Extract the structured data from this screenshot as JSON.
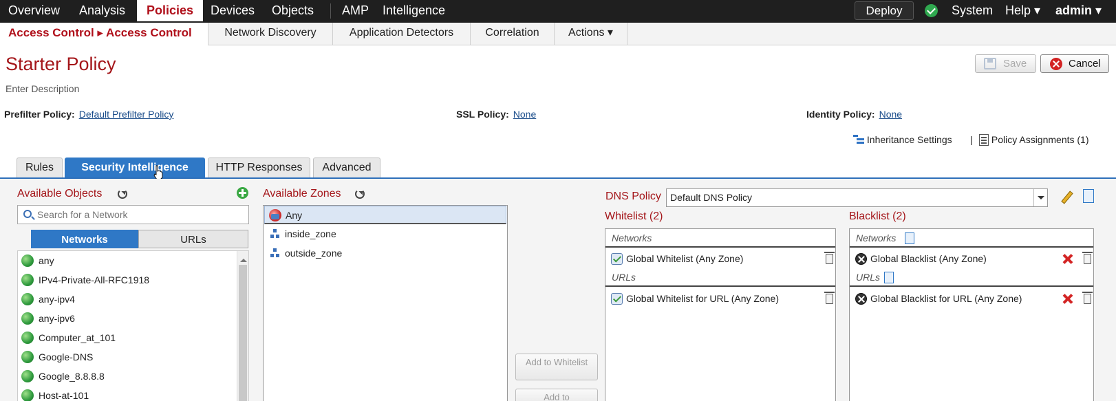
{
  "topnav": {
    "items": [
      "Overview",
      "Analysis",
      "Policies",
      "Devices",
      "Objects",
      "AMP",
      "Intelligence"
    ],
    "deploy": "Deploy",
    "system": "System",
    "help": "Help ▾",
    "user": "admin ▾"
  },
  "subnav": {
    "breadcrumb": "Access Control ▸ Access Control",
    "tabs": [
      "Network Discovery",
      "Application Detectors",
      "Correlation",
      "Actions ▾"
    ]
  },
  "policy": {
    "title": "Starter Policy",
    "description": "Enter Description",
    "save": "Save",
    "cancel": "Cancel",
    "prefilter_label": "Prefilter Policy:",
    "prefilter_value": "Default Prefilter Policy",
    "ssl_label": "SSL Policy:",
    "ssl_value": "None",
    "identity_label": "Identity Policy:",
    "identity_value": "None",
    "inheritance": "Inheritance Settings",
    "assignments": "Policy Assignments (1)",
    "separator": "|"
  },
  "tabs": [
    "Rules",
    "Security Intelligence",
    "HTTP Responses",
    "Advanced"
  ],
  "available_objects": {
    "title": "Available Objects",
    "search_placeholder": "Search for a Network",
    "seg_networks": "Networks",
    "seg_urls": "URLs",
    "items": [
      "any",
      "IPv4-Private-All-RFC1918",
      "any-ipv4",
      "any-ipv6",
      "Computer_at_101",
      "Google-DNS",
      "Google_8.8.8.8",
      "Host-at-101"
    ]
  },
  "available_zones": {
    "title": "Available Zones",
    "items": [
      "Any",
      "inside_zone",
      "outside_zone"
    ]
  },
  "add_buttons": {
    "whitelist": "Add to Whitelist",
    "blacklist": "Add to"
  },
  "dns": {
    "label": "DNS Policy",
    "value": "Default DNS Policy"
  },
  "whitelist": {
    "title": "Whitelist (2)",
    "networks_header": "Networks",
    "network_item": "Global Whitelist (Any Zone)",
    "urls_header": "URLs",
    "url_item": "Global Whitelist for URL (Any Zone)"
  },
  "blacklist": {
    "title": "Blacklist (2)",
    "networks_header": "Networks",
    "network_item": "Global Blacklist (Any Zone)",
    "urls_header": "URLs",
    "url_item": "Global Blacklist for URL (Any Zone)"
  }
}
